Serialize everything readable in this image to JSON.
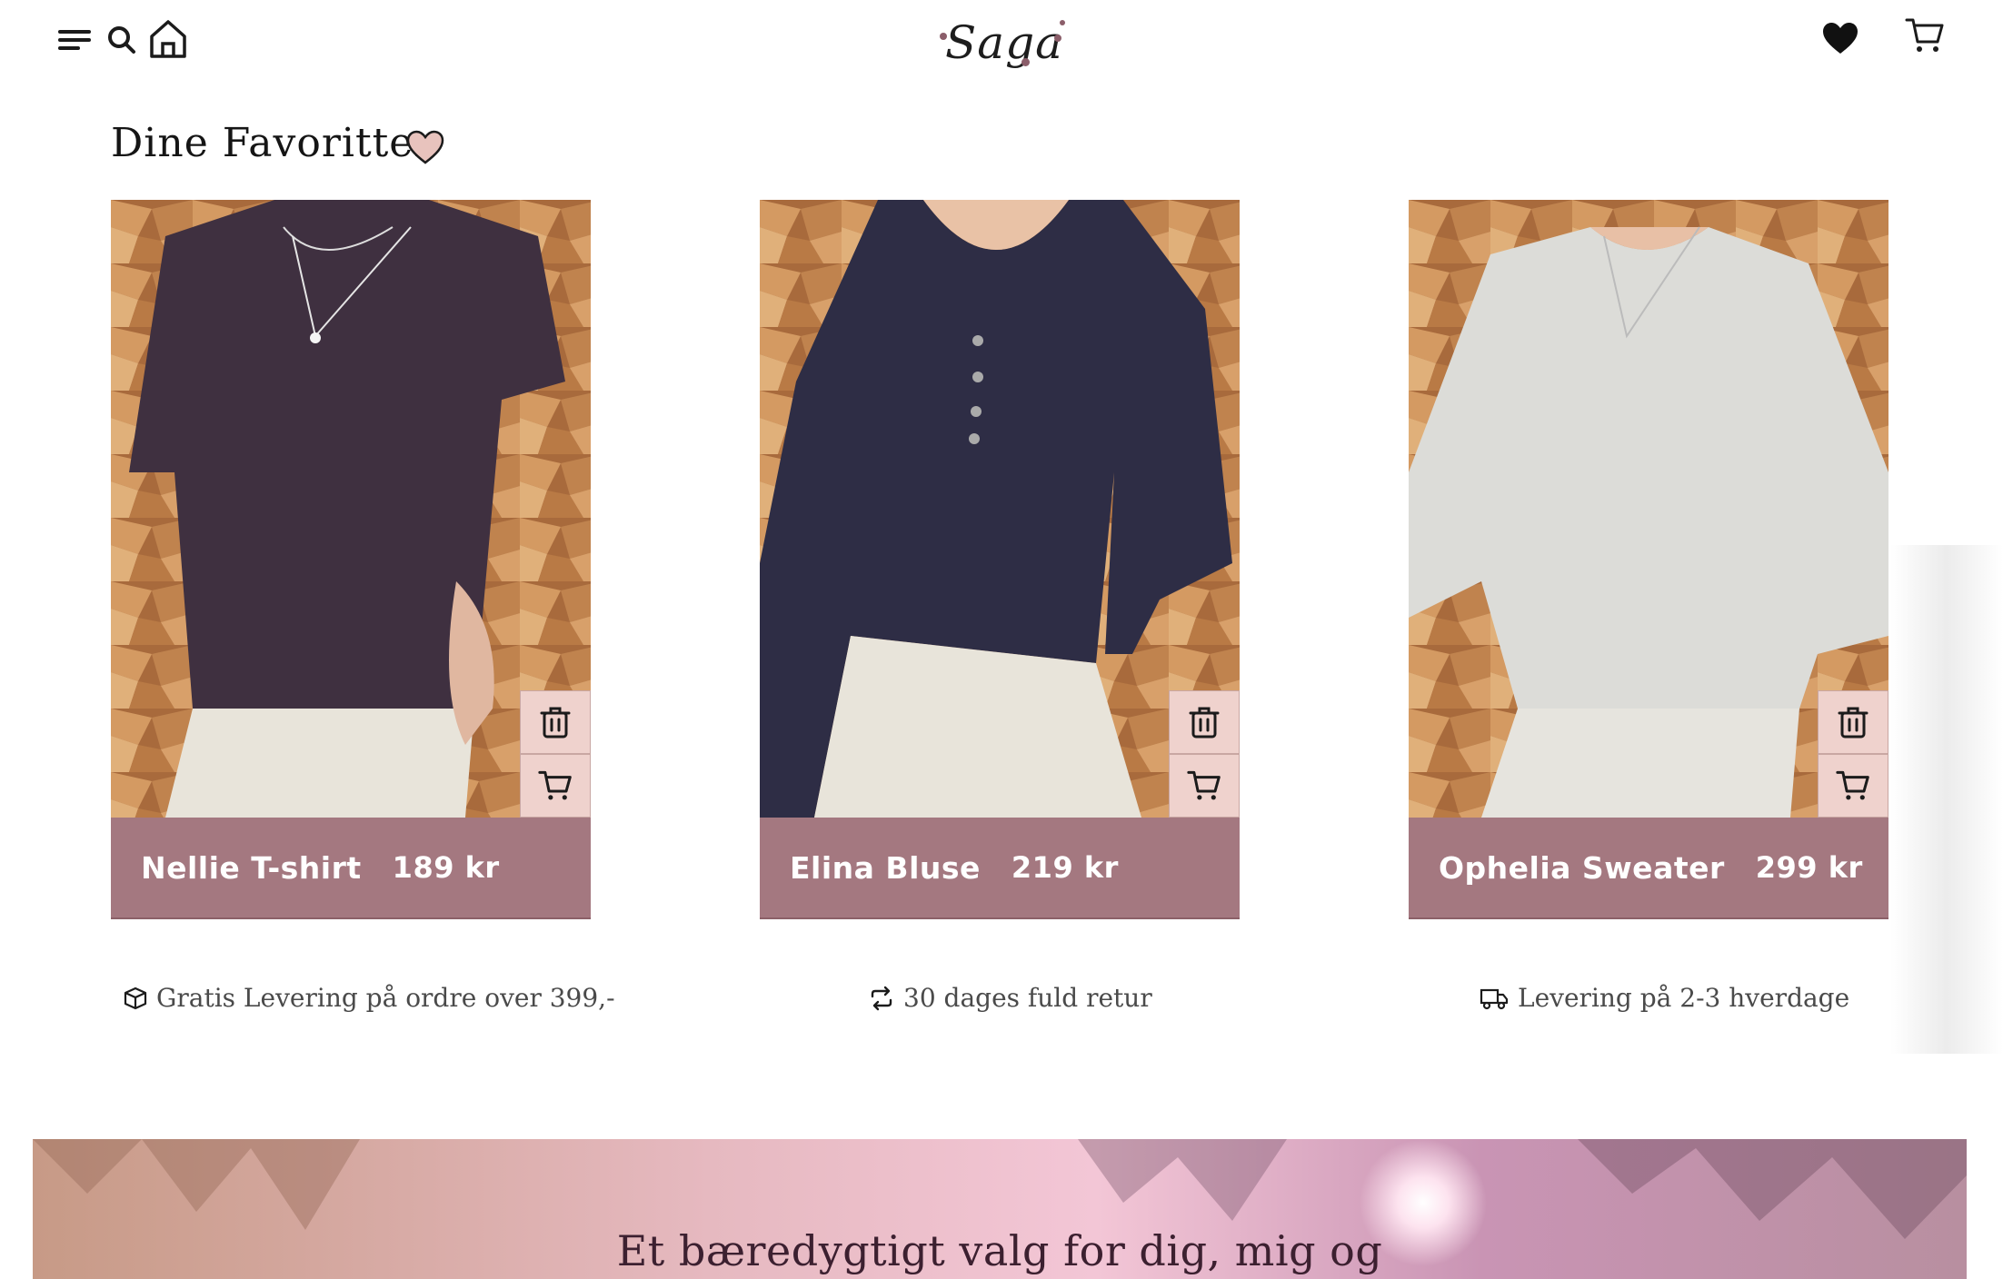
{
  "header": {
    "logo_text": "Saga",
    "icons": [
      "menu-icon",
      "search-icon",
      "home-icon",
      "heart-icon",
      "cart-icon"
    ]
  },
  "page": {
    "title": "Dine Favoritter"
  },
  "products": [
    {
      "name": "Nellie T-shirt",
      "price": "189 kr"
    },
    {
      "name": "Elina Bluse",
      "price": "219 kr"
    },
    {
      "name": "Ophelia Sweater",
      "price": "299 kr"
    }
  ],
  "usps": [
    {
      "icon": "box-icon",
      "text": "Gratis Levering på ordre over 399,-"
    },
    {
      "icon": "return-icon",
      "text": "30 dages fuld retur"
    },
    {
      "icon": "truck-icon",
      "text": "Levering på 2-3 hverdage"
    }
  ],
  "banner": {
    "text": "Et bæredygtigt valg for dig, mig og"
  },
  "colors": {
    "caption_bg": "#a47880",
    "side_button_bg": "#efd2cd",
    "heart_outline_fill": "#e8c3bd",
    "text_dark": "#151515"
  }
}
